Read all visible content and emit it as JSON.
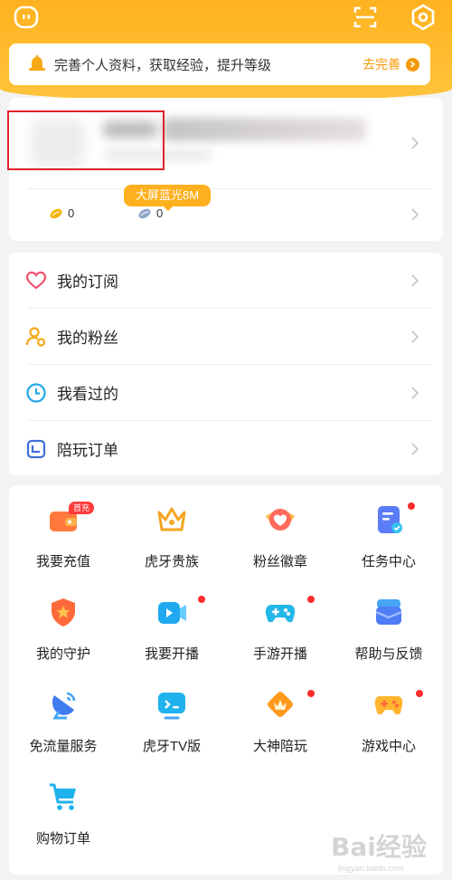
{
  "notice": {
    "text": "完善个人资料，获取经验，提升等级",
    "action": "去完善"
  },
  "profile": {
    "assets": [
      {
        "icon": "gold-bean-icon",
        "value": "0"
      },
      {
        "icon": "silver-bean-icon",
        "value": "0"
      }
    ]
  },
  "menu": [
    {
      "icon": "heart-icon",
      "label": "我的订阅"
    },
    {
      "icon": "fans-icon",
      "label": "我的粉丝"
    },
    {
      "icon": "clock-icon",
      "label": "我看过的"
    },
    {
      "icon": "order-icon",
      "label": "陪玩订单"
    }
  ],
  "grid": [
    {
      "icon": "wallet-icon",
      "label": "我要充值",
      "badge": "首充"
    },
    {
      "icon": "crown-icon",
      "label": "虎牙贵族"
    },
    {
      "icon": "fan-badge-icon",
      "label": "粉丝徽章"
    },
    {
      "icon": "task-icon",
      "label": "任务中心",
      "dot": true
    },
    {
      "icon": "shield-icon",
      "label": "我的守护"
    },
    {
      "icon": "video-camera-icon",
      "label": "我要开播",
      "dot": true
    },
    {
      "icon": "gamepad-icon",
      "label": "手游开播",
      "dot": true
    },
    {
      "icon": "feedback-box-icon",
      "label": "帮助与反馈"
    },
    {
      "icon": "satellite-dish-icon",
      "label": "免流量服务"
    },
    {
      "icon": "tv-icon",
      "label": "虎牙TV版",
      "tag": "大屏蓝光8M"
    },
    {
      "icon": "diamond-icon",
      "label": "大神陪玩",
      "dot": true
    },
    {
      "icon": "game-controller-icon",
      "label": "游戏中心",
      "dot": true
    },
    {
      "icon": "shopping-cart-icon",
      "label": "购物订单"
    }
  ],
  "watermark": {
    "text": "Bai经验",
    "sub": "jingyan.baidu.com"
  },
  "colors": {
    "brand": "#ffb21f",
    "accent": "#f59a0a",
    "dot": "#ff2d2d"
  }
}
